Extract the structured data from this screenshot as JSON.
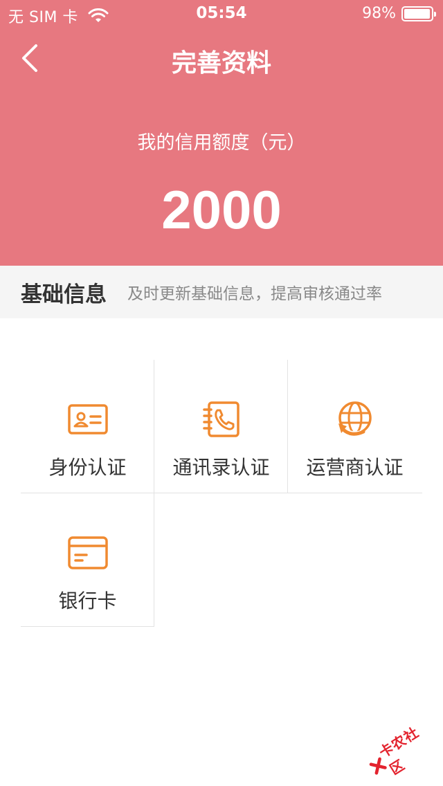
{
  "status_bar": {
    "carrier": "无 SIM 卡",
    "time": "05:54",
    "battery_text": "98%",
    "battery_level": 0.98
  },
  "nav": {
    "title": "完善资料"
  },
  "credit": {
    "label": "我的信用额度（元）",
    "amount": "2000"
  },
  "section": {
    "title": "基础信息",
    "subtitle": "及时更新基础信息，提高审核通过率"
  },
  "items": [
    {
      "label": "身份认证",
      "icon": "id-card-icon"
    },
    {
      "label": "通讯录认证",
      "icon": "contacts-phone-icon"
    },
    {
      "label": "运营商认证",
      "icon": "globe-refresh-icon"
    },
    {
      "label": "银行卡",
      "icon": "bank-card-icon"
    }
  ],
  "watermark": {
    "text": "卡农社区"
  },
  "colors": {
    "header_bg": "#e77880",
    "icon_orange": "#f08a30",
    "section_bg": "#f5f5f5"
  }
}
